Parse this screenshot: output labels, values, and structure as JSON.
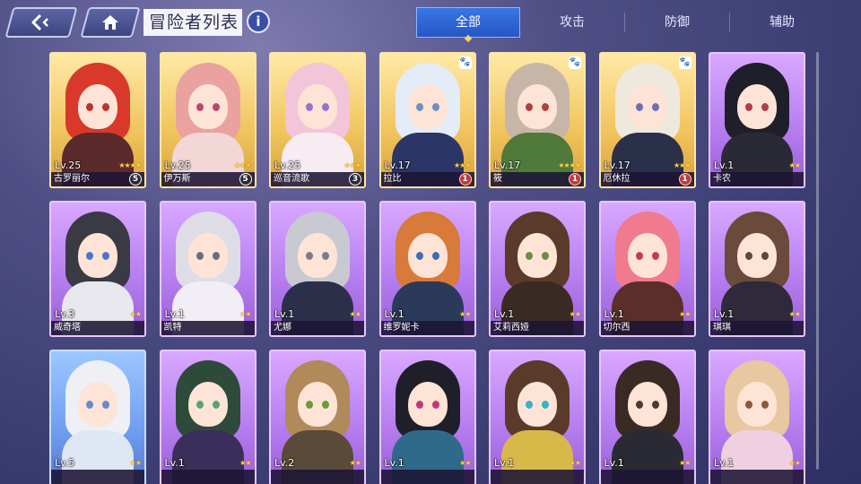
{
  "header": {
    "title": "冒险者列表",
    "info_label": "i"
  },
  "tabs": [
    {
      "label": "全部",
      "active": true
    },
    {
      "label": "攻击",
      "active": false
    },
    {
      "label": "防御",
      "active": false
    },
    {
      "label": "辅助",
      "active": false
    }
  ],
  "colors": {
    "accent": "#2f67d6",
    "star": "#ffd24a"
  },
  "adventurers": [
    {
      "name": "古罗丽尔",
      "level": "Lv.25",
      "stars": "★★★★",
      "frame": "gold",
      "badge": "5",
      "badge_style": "dark",
      "hair": "#d8392b",
      "eye": "#c0302a",
      "outfit": "#5b2a2a",
      "paw": false
    },
    {
      "name": "伊万斯",
      "level": "Lv.25",
      "stars": "★★★",
      "frame": "gold",
      "badge": "5",
      "badge_style": "dark",
      "hair": "#e9a2a0",
      "eye": "#b74a6a",
      "outfit": "#f3d6d6",
      "paw": false
    },
    {
      "name": "巡音流歌",
      "level": "Lv.25",
      "stars": "★★★",
      "frame": "gold",
      "badge": "3",
      "badge_style": "dark",
      "hair": "#f2c6d8",
      "eye": "#9a6fd0",
      "outfit": "#f7ecf2",
      "paw": false
    },
    {
      "name": "拉比",
      "level": "Lv.17",
      "stars": "★★★",
      "frame": "gold",
      "badge": "1",
      "badge_style": "red",
      "hair": "#e3ecf7",
      "eye": "#6f8fc6",
      "outfit": "#2b3566",
      "paw": true
    },
    {
      "name": "筱",
      "level": "Lv.17",
      "stars": "★★★★",
      "frame": "gold",
      "badge": "1",
      "badge_style": "red",
      "hair": "#c7b6a7",
      "eye": "#b24040",
      "outfit": "#4f7a3a",
      "paw": true
    },
    {
      "name": "厄休拉",
      "level": "Lv.17",
      "stars": "★★★",
      "frame": "gold",
      "badge": "1",
      "badge_style": "red",
      "hair": "#efe8dc",
      "eye": "#6d6fb8",
      "outfit": "#2a2f4a",
      "paw": true
    },
    {
      "name": "卡农",
      "level": "Lv.1",
      "stars": "★★",
      "frame": "purple",
      "badge": "",
      "badge_style": "",
      "hair": "#1f1f2b",
      "eye": "#b23a50",
      "outfit": "#2a2a36",
      "paw": false
    },
    {
      "name": "威奇塔",
      "level": "Lv.3",
      "stars": "★★",
      "frame": "purple",
      "badge": "",
      "badge_style": "",
      "hair": "#3a3a44",
      "eye": "#4a76c9",
      "outfit": "#e8e8ee",
      "paw": false
    },
    {
      "name": "凯特",
      "level": "Lv.1",
      "stars": "★★",
      "frame": "purple",
      "badge": "",
      "badge_style": "",
      "hair": "#dedde6",
      "eye": "#6b6b7a",
      "outfit": "#f2eef6",
      "paw": false
    },
    {
      "name": "尤娜",
      "level": "Lv.1",
      "stars": "★★",
      "frame": "purple",
      "badge": "",
      "badge_style": "",
      "hair": "#c9c9d2",
      "eye": "#7b7b8a",
      "outfit": "#2c2f4a",
      "paw": false
    },
    {
      "name": "维罗妮卡",
      "level": "Lv.1",
      "stars": "★★",
      "frame": "purple",
      "badge": "",
      "badge_style": "",
      "hair": "#d77a3a",
      "eye": "#3a6fb0",
      "outfit": "#2b3a5a",
      "paw": false
    },
    {
      "name": "艾莉西娅",
      "level": "Lv.1",
      "stars": "★★",
      "frame": "purple",
      "badge": "",
      "badge_style": "",
      "hair": "#5a3a2a",
      "eye": "#6f8a4a",
      "outfit": "#3a2a24",
      "paw": false
    },
    {
      "name": "切尔西",
      "level": "Lv.1",
      "stars": "★★",
      "frame": "purple",
      "badge": "",
      "badge_style": "",
      "hair": "#f07a8e",
      "eye": "#c33a5a",
      "outfit": "#5a2f2a",
      "paw": false
    },
    {
      "name": "琪琪",
      "level": "Lv.1",
      "stars": "★★",
      "frame": "purple",
      "badge": "",
      "badge_style": "",
      "hair": "#6a4a3a",
      "eye": "#5a4a3a",
      "outfit": "#2e2a3a",
      "paw": false
    },
    {
      "name": "",
      "level": "Lv.5",
      "stars": "★★",
      "frame": "blue",
      "badge": "",
      "badge_style": "",
      "hair": "#eef0f6",
      "eye": "#6a8ac9",
      "outfit": "#dfe6f4",
      "paw": false
    },
    {
      "name": "",
      "level": "Lv.1",
      "stars": "★★",
      "frame": "purple",
      "badge": "",
      "badge_style": "",
      "hair": "#2d4a3a",
      "eye": "#5aa07a",
      "outfit": "#3a2f5a",
      "paw": false
    },
    {
      "name": "",
      "level": "Lv.2",
      "stars": "★★",
      "frame": "purple",
      "badge": "",
      "badge_style": "",
      "hair": "#b08a5a",
      "eye": "#6a9a3a",
      "outfit": "#5a4a3a",
      "paw": false
    },
    {
      "name": "",
      "level": "Lv.1",
      "stars": "★★",
      "frame": "purple",
      "badge": "",
      "badge_style": "",
      "hair": "#1f1f2a",
      "eye": "#c03a7a",
      "outfit": "#2f6a8a",
      "paw": false
    },
    {
      "name": "",
      "level": "Lv.1",
      "stars": "★★",
      "frame": "purple",
      "badge": "",
      "badge_style": "",
      "hair": "#5a3a2a",
      "eye": "#3ab0c9",
      "outfit": "#d9b84a",
      "paw": false
    },
    {
      "name": "",
      "level": "Lv.1",
      "stars": "★★",
      "frame": "purple",
      "badge": "",
      "badge_style": "",
      "hair": "#3a2a24",
      "eye": "#4a3a34",
      "outfit": "#2a2a34",
      "paw": false
    },
    {
      "name": "",
      "level": "Lv.1",
      "stars": "★★",
      "frame": "purple",
      "badge": "",
      "badge_style": "",
      "hair": "#e8c8a0",
      "eye": "#8a5a3a",
      "outfit": "#f0d0e0",
      "paw": false
    }
  ]
}
